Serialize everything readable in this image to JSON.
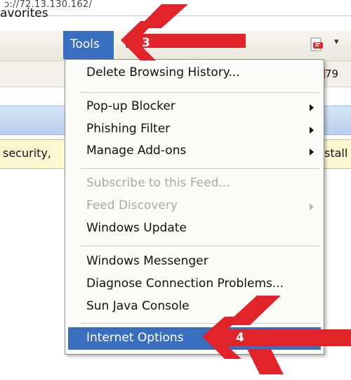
{
  "address": {
    "text": "ɔ://72.13.130.162/"
  },
  "menu_bar": {
    "favorites": "avorites",
    "tools": "Tools",
    "help": "H",
    "pdf_dropdown": "▾"
  },
  "toolbar": {
    "count": "79"
  },
  "info_bar": {
    "left_text": "security,",
    "right_text": "stall"
  },
  "tools_menu": {
    "items": [
      {
        "label": "Delete Browsing History...",
        "enabled": true,
        "submenu": false
      },
      {
        "label": "Pop-up Blocker",
        "enabled": true,
        "submenu": true
      },
      {
        "label": "Phishing Filter",
        "enabled": true,
        "submenu": true
      },
      {
        "label": "Manage Add-ons",
        "enabled": true,
        "submenu": true
      },
      {
        "label": "Subscribe to this Feed...",
        "enabled": false,
        "submenu": false
      },
      {
        "label": "Feed Discovery",
        "enabled": false,
        "submenu": true
      },
      {
        "label": "Windows Update",
        "enabled": true,
        "submenu": false
      },
      {
        "label": "Windows Messenger",
        "enabled": true,
        "submenu": false
      },
      {
        "label": "Diagnose Connection Problems...",
        "enabled": true,
        "submenu": false
      },
      {
        "label": "Sun Java Console",
        "enabled": true,
        "submenu": false
      },
      {
        "label": "Internet Options",
        "enabled": true,
        "submenu": false,
        "highlighted": true
      }
    ]
  },
  "annotations": {
    "step3": "3",
    "step4": "4"
  },
  "colors": {
    "highlight": "#3a6fc0",
    "arrow_red": "#e0242a",
    "info_bar": "#fff7d2"
  }
}
